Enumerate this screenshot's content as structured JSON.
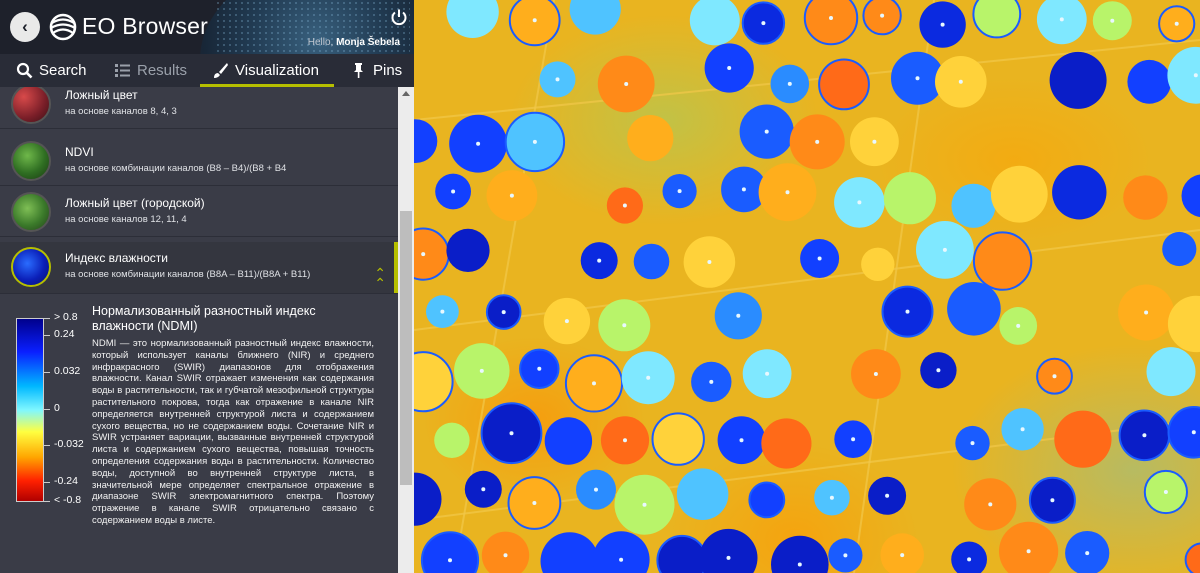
{
  "app": {
    "title": "EO Browser",
    "greeting": "Hello,",
    "user_name": "Monja Šebela"
  },
  "tabs": [
    {
      "label": "Search",
      "icon": "search-icon",
      "state": "normal"
    },
    {
      "label": "Results",
      "icon": "list-icon",
      "state": "dimmed"
    },
    {
      "label": "Visualization",
      "icon": "brush-icon",
      "state": "active"
    },
    {
      "label": "Pins",
      "icon": "pin-icon",
      "state": "normal"
    }
  ],
  "visualizations": [
    {
      "title": "Ложный цвет",
      "subtitle": "на основе каналов 8, 4, 3"
    },
    {
      "title": "NDVI",
      "subtitle": "на основе комбинации каналов (B8 – B4)/(B8 + B4"
    },
    {
      "title": "Ложный цвет (городской)",
      "subtitle": "на основе каналов 12, 11, 4"
    },
    {
      "title": "Индекс влажности",
      "subtitle": "на основе комбинации каналов (B8A – B11)/(B8A + B11)",
      "selected": true
    }
  ],
  "legend": {
    "title": "Нормализованный разностный индекс влажности (NDMI)",
    "ticks": [
      "> 0.8",
      "0.24",
      "0.032",
      "0",
      "-0.032",
      "-0.24",
      "< -0.8"
    ],
    "description": "NDMI — это нормализованный разностный индекс влажности, который использует каналы ближнего (NIR) и среднего инфракрасного (SWIR) диапазонов для отображения влажности. Канал SWIR отражает изменения как содержания воды в растительности, так и губчатой мезофильной структуры растительного покрова, тогда как отражение в канале NIR определяется внутренней структурой листа и содержанием сухого вещества, но не содержанием воды. Сочетание NIR и SWIR устраняет вариации, вызванные внутренней структурой листа и содержанием сухого вещества, повышая точность определения содержания воды в растительности. Количество воды, доступной во внутренней структуре листа, в значительной мере определяет спектральное отражение в диапазоне SWIR электромагнитного спектра. Поэтому отражение в канале SWIR отрицательно связано с содержанием воды в листе."
  },
  "colors": {
    "accent": "#b6bf00",
    "panel_bg": "#3a3c47",
    "header_bg": "#1e212b"
  }
}
